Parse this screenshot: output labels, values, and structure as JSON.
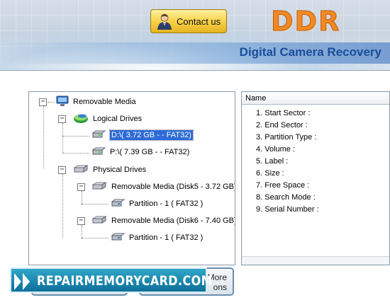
{
  "header": {
    "contact_label": "Contact us",
    "logo_text": "DDR",
    "product_name": "Digital Camera Recovery"
  },
  "tree": {
    "root": "Removable Media",
    "logical_drives_label": "Logical Drives",
    "drive_d": "D:\\( 3.72 GB -  - FAT32)",
    "drive_p": "P:\\( 7.39 GB -  - FAT32)",
    "physical_drives_label": "Physical Drives",
    "disk5": "Removable Media (Disk5 - 3.72 GB)",
    "disk5_partition": "Partition - 1 ( FAT32 )",
    "disk6": "Removable Media (Disk6 - 7.40 GB)",
    "disk6_partition": "Partition - 1 ( FAT32 )"
  },
  "grid": {
    "column_header": "Name",
    "rows": [
      "1. Start Sector :",
      "2. End Sector :",
      "3. Partition Type :",
      "4. Volume :",
      "5. Label :",
      "6. Size :",
      "7. Free Space :",
      "8. Search Mode :",
      "9. Serial Number :"
    ]
  },
  "buttons": {
    "more_options_line1": "More",
    "more_options_line2": "ons"
  },
  "banner": {
    "text": "REPAIRMEMORYCARD.COM"
  },
  "colors": {
    "accent_blue": "#1a4d9c",
    "logo_orange": "#f08a24",
    "selection": "#2e6bd6",
    "banner": "#0d6f9a"
  }
}
